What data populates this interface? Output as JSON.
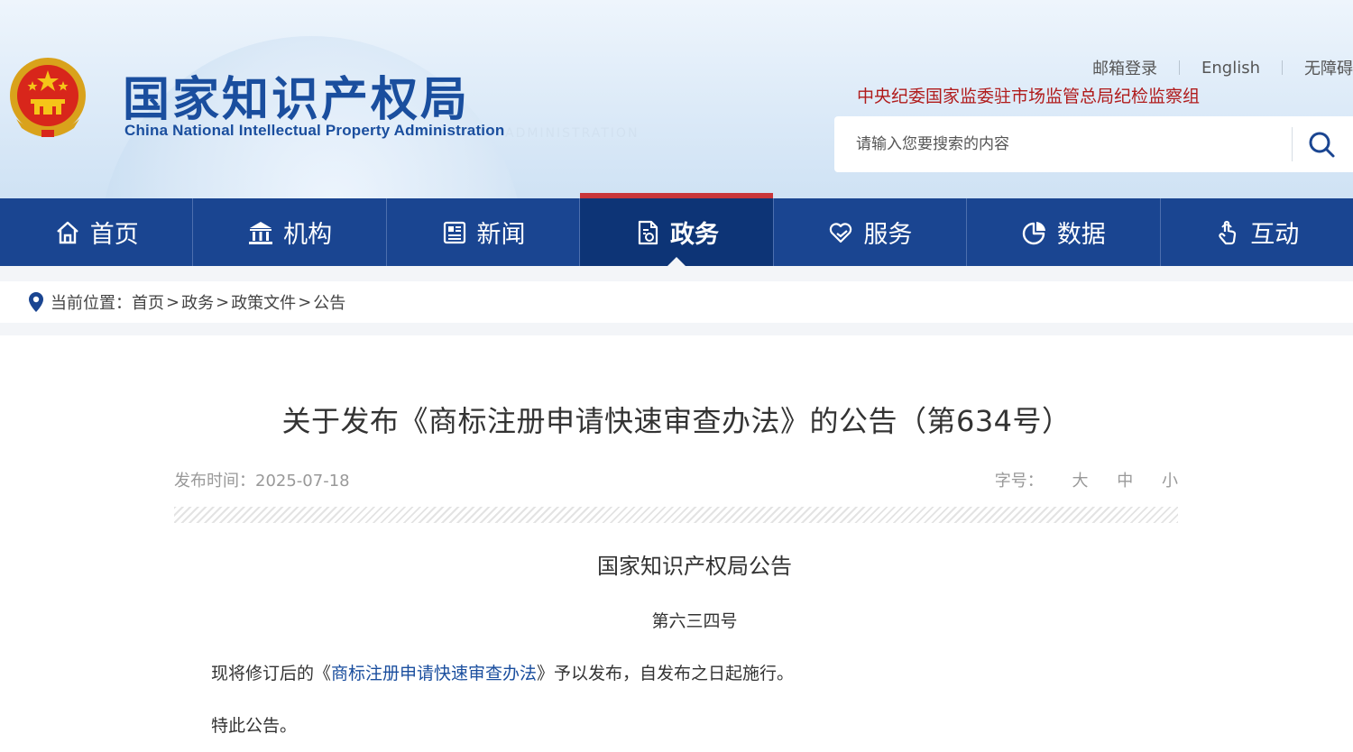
{
  "header": {
    "logo_cn": "国家知识产权局",
    "logo_en": "China National Intellectual Property Administration",
    "top_links": [
      "邮箱登录",
      "English",
      "无障碍"
    ],
    "discipline_link": "中央纪委国家监委驻市场监管总局纪检监察组",
    "search": {
      "placeholder": "请输入您要搜索的内容"
    }
  },
  "nav": {
    "items": [
      {
        "label": "首页",
        "icon": "home-icon"
      },
      {
        "label": "机构",
        "icon": "institution-icon"
      },
      {
        "label": "新闻",
        "icon": "news-icon"
      },
      {
        "label": "政务",
        "icon": "document-icon",
        "active": true
      },
      {
        "label": "服务",
        "icon": "heart-hand-icon"
      },
      {
        "label": "数据",
        "icon": "pie-chart-icon"
      },
      {
        "label": "互动",
        "icon": "hand-pointer-icon"
      }
    ]
  },
  "breadcrumb": {
    "label": "当前位置：",
    "items": [
      "首页",
      "政务",
      "政策文件",
      "公告"
    ],
    "separator": ">"
  },
  "article": {
    "title": "关于发布《商标注册申请快速审查办法》的公告（第634号）",
    "publish_label": "发布时间：",
    "publish_date": "2025-07-18",
    "font_size_label": "字号：",
    "font_sizes": [
      "大",
      "中",
      "小"
    ],
    "body_title": "国家知识产权局公告",
    "body_number": "第六三四号",
    "para1_before": "现将修订后的《",
    "para1_link": "商标注册申请快速审查办法",
    "para1_after": "》予以发布，自发布之日起施行。",
    "para2": "特此公告。"
  },
  "colors": {
    "nav_bg": "#1a4591",
    "nav_active_bg": "#0d3476",
    "nav_active_bar": "#c9363a",
    "brand_blue": "#1a4e9e",
    "discipline_red": "#b01b1b"
  }
}
